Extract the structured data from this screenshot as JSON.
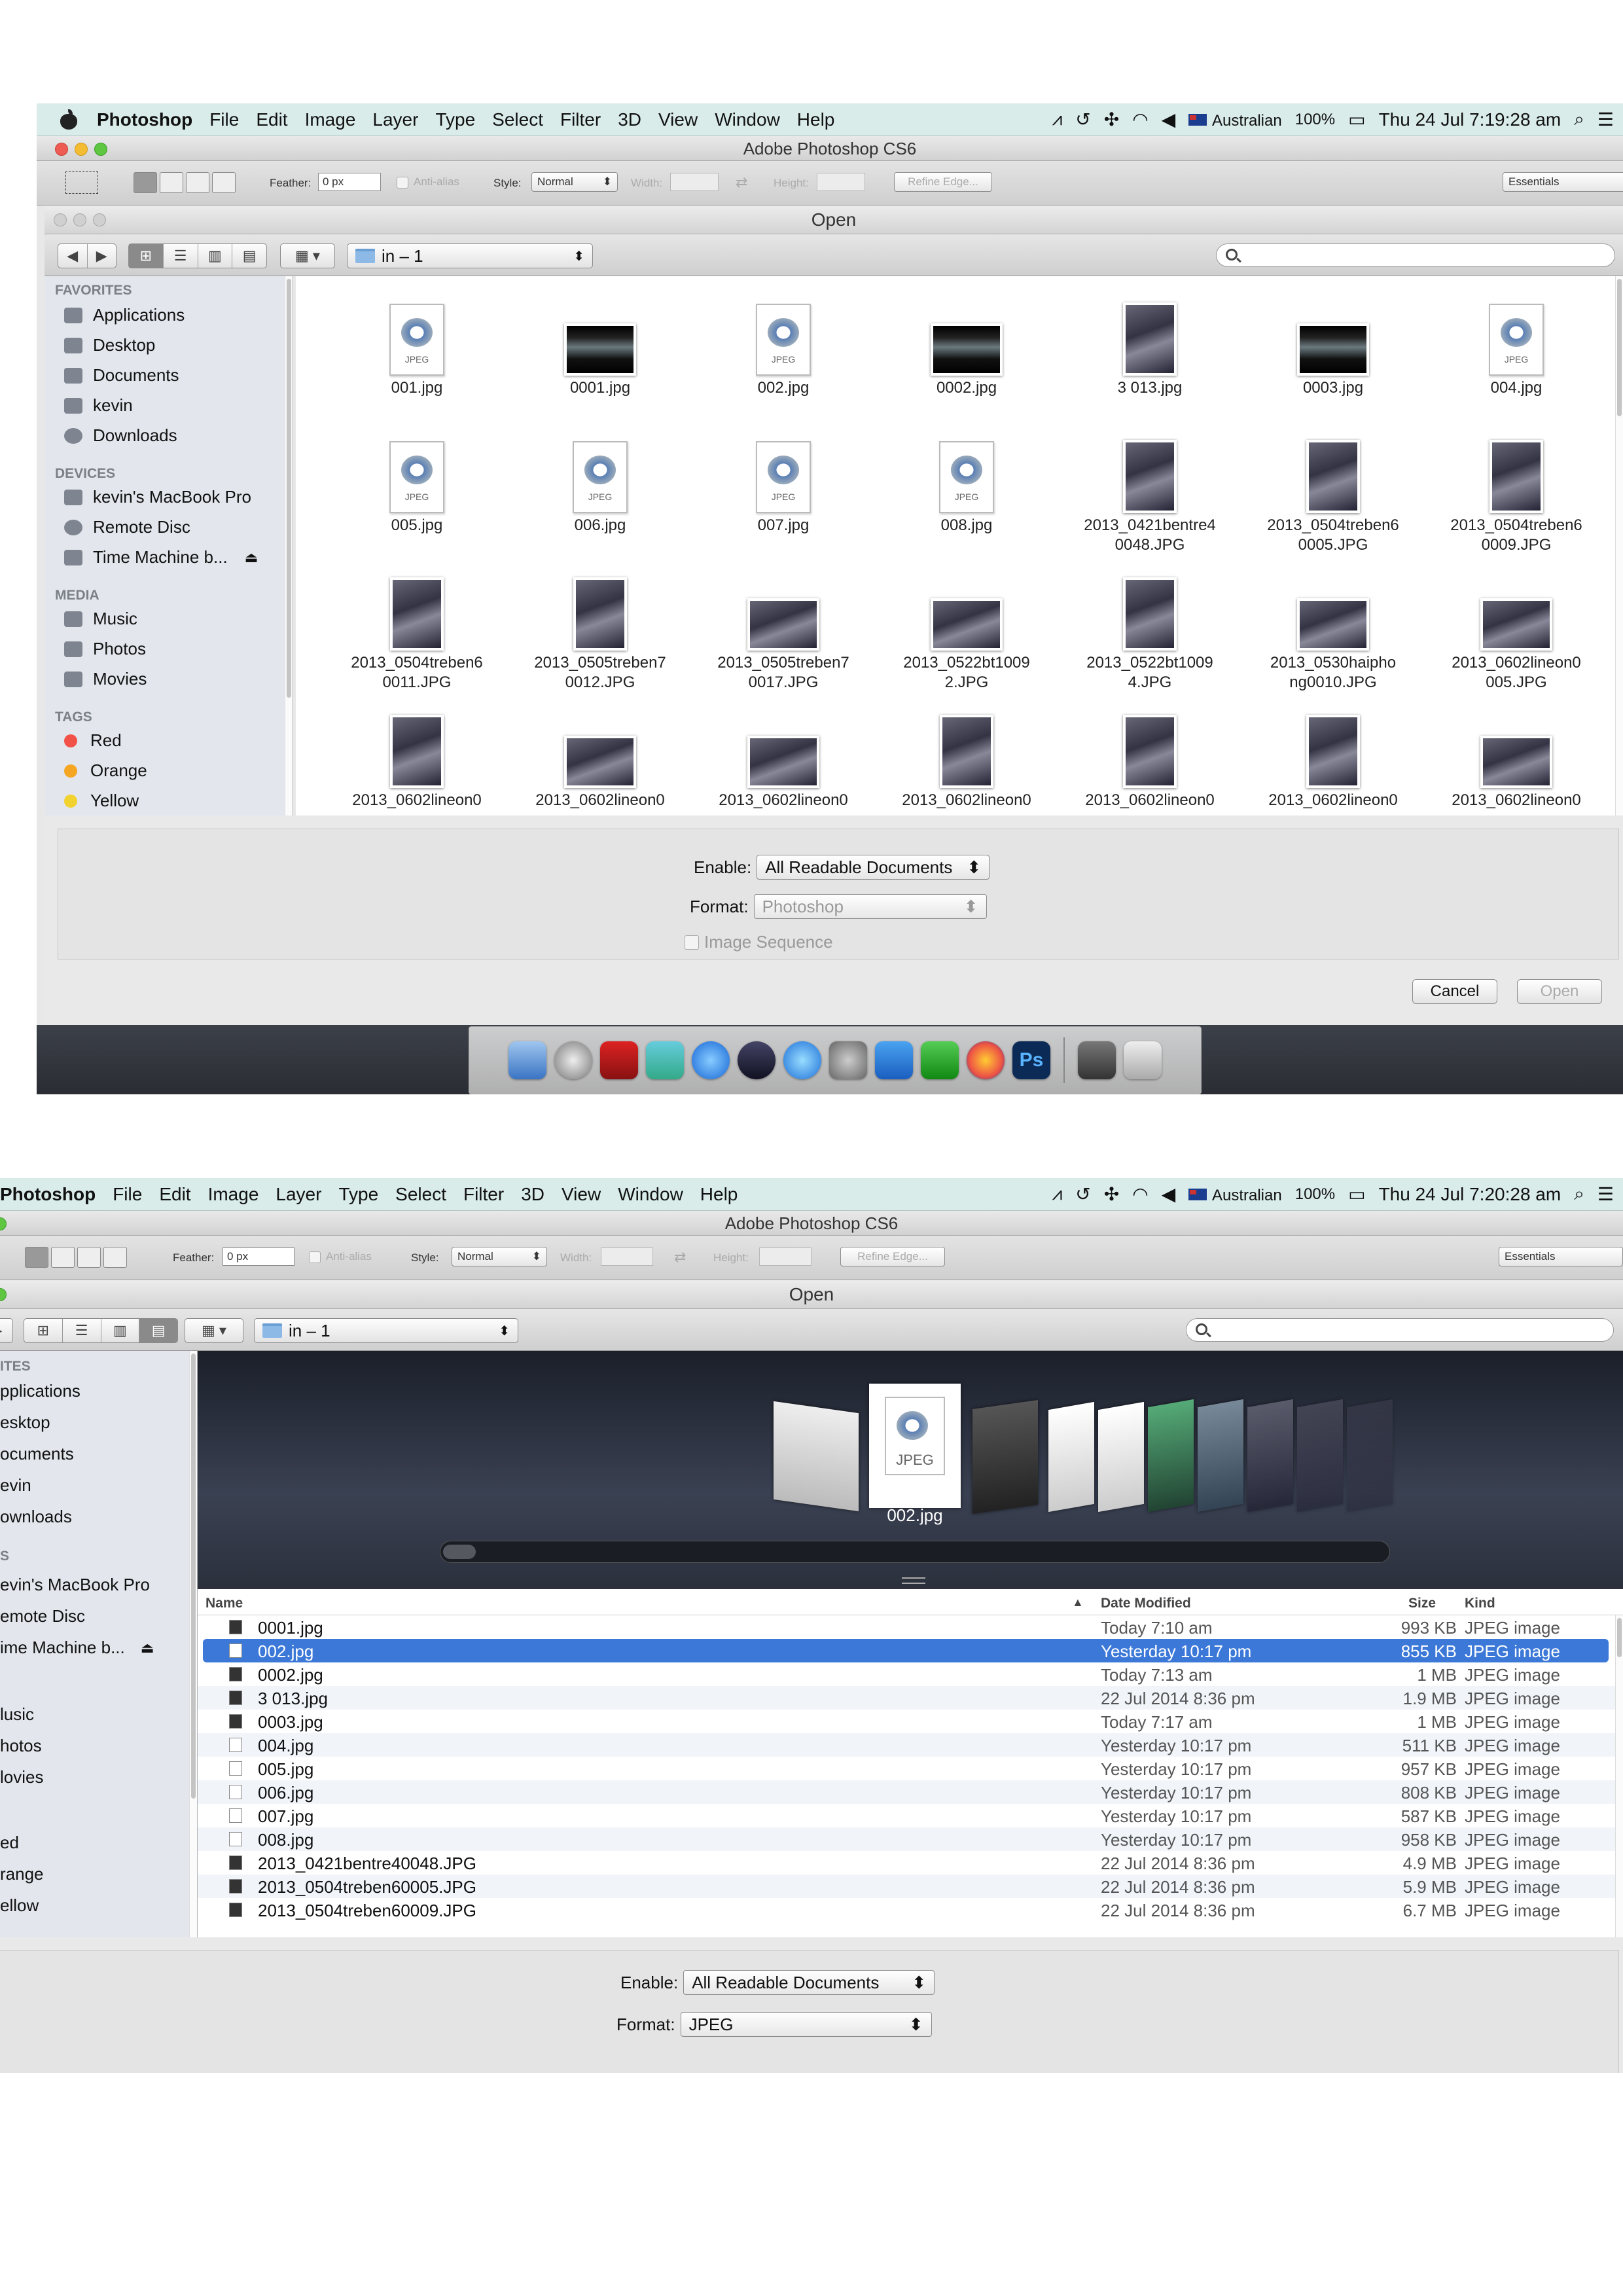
{
  "menubar": {
    "app": "Photoshop",
    "items": [
      "File",
      "Edit",
      "Image",
      "Layer",
      "Type",
      "Select",
      "Filter",
      "3D",
      "View",
      "Window",
      "Help"
    ],
    "input_source": "Australian",
    "battery": "100%"
  },
  "shot1": {
    "clock": "Thu 24 Jul  7:19:28 am"
  },
  "shot2": {
    "clock": "Thu 24 Jul  7:20:28 am"
  },
  "app_window": {
    "title": "Adobe Photoshop CS6"
  },
  "options_bar": {
    "feather_label": "Feather:",
    "feather_value": "0 px",
    "antialias_label": "Anti-alias",
    "style_label": "Style:",
    "style_value": "Normal",
    "width_label": "Width:",
    "height_label": "Height:",
    "refine_edge": "Refine Edge...",
    "workspace": "Essentials"
  },
  "dialog": {
    "title": "Open",
    "location": "in – 1",
    "enable_label": "Enable:",
    "enable_value": "All Readable Documents",
    "format_label": "Format:",
    "image_sequence": "Image Sequence",
    "cancel": "Cancel",
    "open": "Open"
  },
  "shot1_format": "Photoshop",
  "shot2_format": "JPEG",
  "sidebar": {
    "favorites_header": "FAVORITES",
    "favorites": [
      "Applications",
      "Desktop",
      "Documents",
      "kevin",
      "Downloads"
    ],
    "devices_header": "DEVICES",
    "devices": [
      "kevin's MacBook Pro",
      "Remote Disc",
      "Time Machine b..."
    ],
    "media_header": "MEDIA",
    "media": [
      "Music",
      "Photos",
      "Movies"
    ],
    "tags_header": "TAGS",
    "tags": [
      "Red",
      "Orange",
      "Yellow"
    ],
    "tag_colors": [
      "#f25147",
      "#f5a623",
      "#f2d22e"
    ]
  },
  "sidebar_cropped": {
    "favorites_header": "ITES",
    "favorites": [
      "pplications",
      "esktop",
      "ocuments",
      "evin",
      "ownloads"
    ],
    "devices_header": "S",
    "devices": [
      "evin's MacBook Pro",
      "emote Disc",
      "ime Machine b..."
    ],
    "media": [
      "lusic",
      "hotos",
      "lovies"
    ],
    "tags": [
      "ed",
      "range",
      "ellow"
    ]
  },
  "icon_grid": {
    "doc_badge": "JPEG",
    "row1": [
      "001.jpg",
      "0001.jpg",
      "002.jpg",
      "0002.jpg",
      "3 013.jpg",
      "0003.jpg",
      "004.jpg"
    ],
    "row2": [
      "005.jpg",
      "006.jpg",
      "007.jpg",
      "008.jpg",
      "2013_0421bentre4|0048.JPG",
      "2013_0504treben6|0005.JPG",
      "2013_0504treben6|0009.JPG"
    ],
    "row3": [
      "2013_0504treben6|0011.JPG",
      "2013_0505treben7|0012.JPG",
      "2013_0505treben7|0017.JPG",
      "2013_0522bt1009|2.JPG",
      "2013_0522bt1009|4.JPG",
      "2013_0530haipho|ng0010.JPG",
      "2013_0602lineon0|005.JPG"
    ],
    "row4": [
      "2013_0602lineon0",
      "2013_0602lineon0",
      "2013_0602lineon0",
      "2013_0602lineon0",
      "2013_0602lineon0",
      "2013_0602lineon0",
      "2013_0602lineon0"
    ]
  },
  "coverflow": {
    "caption": "002.jpg",
    "badge": "JPEG"
  },
  "list": {
    "headers": {
      "name": "Name",
      "date": "Date Modified",
      "size": "Size",
      "kind": "Kind"
    },
    "rows": [
      {
        "name": "0001.jpg",
        "date": "Today 7:10 am",
        "size": "993 KB",
        "kind": "JPEG image"
      },
      {
        "name": "002.jpg",
        "date": "Yesterday 10:17 pm",
        "size": "855 KB",
        "kind": "JPEG image"
      },
      {
        "name": "0002.jpg",
        "date": "Today 7:13 am",
        "size": "1 MB",
        "kind": "JPEG image"
      },
      {
        "name": "3 013.jpg",
        "date": "22 Jul 2014 8:36 pm",
        "size": "1.9 MB",
        "kind": "JPEG image"
      },
      {
        "name": "0003.jpg",
        "date": "Today 7:17 am",
        "size": "1 MB",
        "kind": "JPEG image"
      },
      {
        "name": "004.jpg",
        "date": "Yesterday 10:17 pm",
        "size": "511 KB",
        "kind": "JPEG image"
      },
      {
        "name": "005.jpg",
        "date": "Yesterday 10:17 pm",
        "size": "957 KB",
        "kind": "JPEG image"
      },
      {
        "name": "006.jpg",
        "date": "Yesterday 10:17 pm",
        "size": "808 KB",
        "kind": "JPEG image"
      },
      {
        "name": "007.jpg",
        "date": "Yesterday 10:17 pm",
        "size": "587 KB",
        "kind": "JPEG image"
      },
      {
        "name": "008.jpg",
        "date": "Yesterday 10:17 pm",
        "size": "958 KB",
        "kind": "JPEG image"
      },
      {
        "name": "2013_0421bentre40048.JPG",
        "date": "22 Jul 2014 8:36 pm",
        "size": "4.9 MB",
        "kind": "JPEG image"
      },
      {
        "name": "2013_0504treben60005.JPG",
        "date": "22 Jul 2014 8:36 pm",
        "size": "5.9 MB",
        "kind": "JPEG image"
      },
      {
        "name": "2013_0504treben60009.JPG",
        "date": "22 Jul 2014 8:36 pm",
        "size": "6.7 MB",
        "kind": "JPEG image"
      }
    ],
    "selected_index": 1
  }
}
